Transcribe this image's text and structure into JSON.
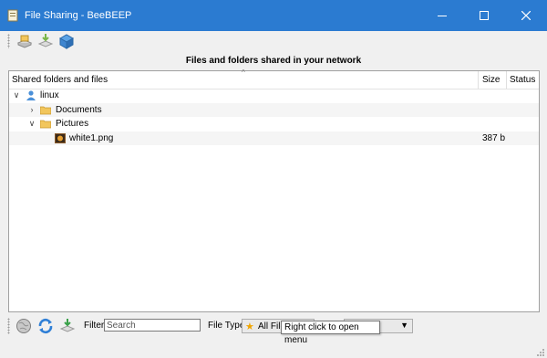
{
  "window": {
    "title": "File Sharing - BeeBEEP",
    "minimize_symbol": "—",
    "maximize_symbol": "☐",
    "close_symbol": "✕"
  },
  "toolbar": {
    "icons": [
      "share-folder-icon",
      "download-icon",
      "network-box-icon"
    ]
  },
  "header": {
    "text": "Files and folders shared in your network"
  },
  "tree": {
    "sort_caret": "^",
    "columns": [
      "Shared folders and files",
      "Size",
      "Status"
    ],
    "rows": [
      {
        "label": "linux",
        "chevron": "∨",
        "icon": "user-icon",
        "size": ""
      },
      {
        "label": "Documents",
        "chevron": "›",
        "icon": "folder-icon",
        "size": ""
      },
      {
        "label": "Pictures",
        "chevron": "∨",
        "icon": "folder-icon",
        "size": ""
      },
      {
        "label": "white1.png",
        "chevron": "",
        "icon": "image-file-icon",
        "size": "387 b"
      }
    ]
  },
  "bottom": {
    "filter_label": "Filter",
    "filter_placeholder": "Search",
    "filter_value": "",
    "file_type_label": "File Type",
    "file_type_value": "All Files",
    "second_dropdown_value": "",
    "tooltip": "Right click to open menu"
  },
  "colors": {
    "titlebar": "#2b7bd1",
    "window_bg": "#f0f0f0",
    "folder": "#f2c65c",
    "user": "#4a90d9"
  }
}
